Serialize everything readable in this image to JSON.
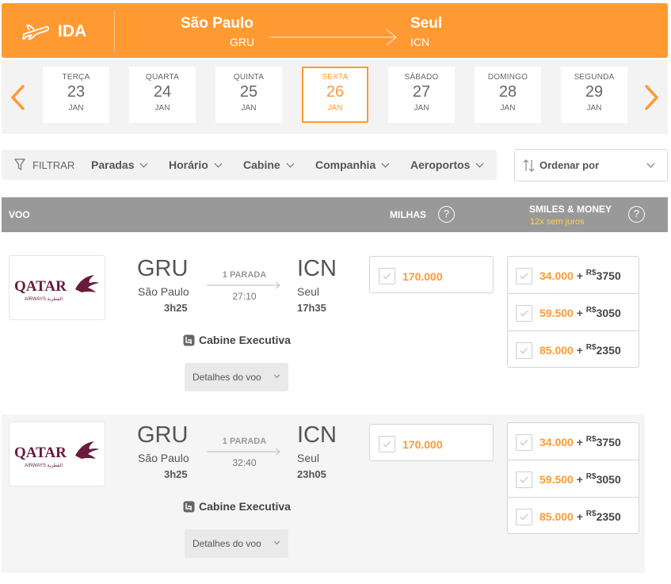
{
  "header": {
    "direction": "IDA",
    "origin_city": "São Paulo",
    "origin_code": "GRU",
    "destination_city": "Seul",
    "destination_code": "ICN",
    "accent_color": "#ff9a33"
  },
  "dates": [
    {
      "dow": "TERÇA",
      "day": "23",
      "month": "JAN",
      "selected": false
    },
    {
      "dow": "QUARTA",
      "day": "24",
      "month": "JAN",
      "selected": false
    },
    {
      "dow": "QUINTA",
      "day": "25",
      "month": "JAN",
      "selected": false
    },
    {
      "dow": "SEXTA",
      "day": "26",
      "month": "JAN",
      "selected": true
    },
    {
      "dow": "SÁBADO",
      "day": "27",
      "month": "JAN",
      "selected": false
    },
    {
      "dow": "DOMINGO",
      "day": "28",
      "month": "JAN",
      "selected": false
    },
    {
      "dow": "SEGUNDA",
      "day": "29",
      "month": "JAN",
      "selected": false
    }
  ],
  "filters": {
    "label": "FILTRAR",
    "items": [
      "Paradas",
      "Horário",
      "Cabine",
      "Companhia",
      "Aeroportos"
    ],
    "sort_label": "Ordenar por"
  },
  "results_header": {
    "flight_col": "VOO",
    "miles_col": "MILHAS",
    "smiles_money_col": "SMILES & MONEY",
    "installments": "12x sem juros",
    "help_icon": "?"
  },
  "flights": [
    {
      "airline": "QATAR",
      "airline_sub": "AIRWAYS القطرية",
      "origin_code": "GRU",
      "origin_city": "São Paulo",
      "departure": "3h25",
      "stops": "1 PARADA",
      "duration": "27:10",
      "destination_code": "ICN",
      "destination_city": "Seul",
      "arrival": "17h35",
      "cabin": "Cabine Executiva",
      "details": "Detalhes do voo",
      "miles": "170.000",
      "smiles_money": [
        {
          "miles": "34.000",
          "plus": "+",
          "currency": "R$",
          "amount": "3750"
        },
        {
          "miles": "59.500",
          "plus": "+",
          "currency": "R$",
          "amount": "3050"
        },
        {
          "miles": "85.000",
          "plus": "+",
          "currency": "R$",
          "amount": "2350"
        }
      ]
    },
    {
      "airline": "QATAR",
      "airline_sub": "AIRWAYS القطرية",
      "origin_code": "GRU",
      "origin_city": "São Paulo",
      "departure": "3h25",
      "stops": "1 PARADA",
      "duration": "32:40",
      "destination_code": "ICN",
      "destination_city": "Seul",
      "arrival": "23h05",
      "cabin": "Cabine Executiva",
      "details": "Detalhes do voo",
      "miles": "170.000",
      "smiles_money": [
        {
          "miles": "34.000",
          "plus": "+",
          "currency": "R$",
          "amount": "3750"
        },
        {
          "miles": "59.500",
          "plus": "+",
          "currency": "R$",
          "amount": "3050"
        },
        {
          "miles": "85.000",
          "plus": "+",
          "currency": "R$",
          "amount": "2350"
        }
      ]
    }
  ]
}
